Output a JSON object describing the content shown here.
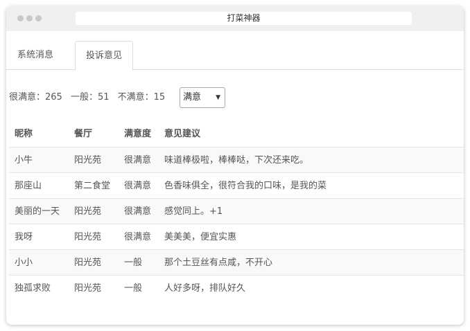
{
  "window": {
    "title": "打菜神器"
  },
  "tabs": [
    {
      "label": "系统消息",
      "active": false
    },
    {
      "label": "投诉意见",
      "active": true
    }
  ],
  "summary": {
    "very_satisfied": "很满意：265",
    "average": "一般：51",
    "dissatisfied": "不满意：15"
  },
  "filter": {
    "selected": "满意",
    "arrow": "▼"
  },
  "table": {
    "headers": [
      "昵称",
      "餐厅",
      "满意度",
      "意见建议"
    ],
    "rows": [
      [
        "小牛",
        "阳光苑",
        "很满意",
        "味道棒极啦，棒棒哒，下次还来吃。"
      ],
      [
        "那座山",
        "第二食堂",
        "很满意",
        "色香味俱全，很符合我的口味，是我的菜"
      ],
      [
        "美丽的一天",
        "阳光苑",
        "很满意",
        "感觉同上。+1"
      ],
      [
        "我呀",
        "阳光苑",
        "很满意",
        "美美美，便宜实惠"
      ],
      [
        "小小",
        "阳光苑",
        "一般",
        "那个土豆丝有点咸，不开心"
      ],
      [
        "独孤求败",
        "阳光苑",
        "一般",
        "人好多呀，排队好久"
      ]
    ]
  }
}
